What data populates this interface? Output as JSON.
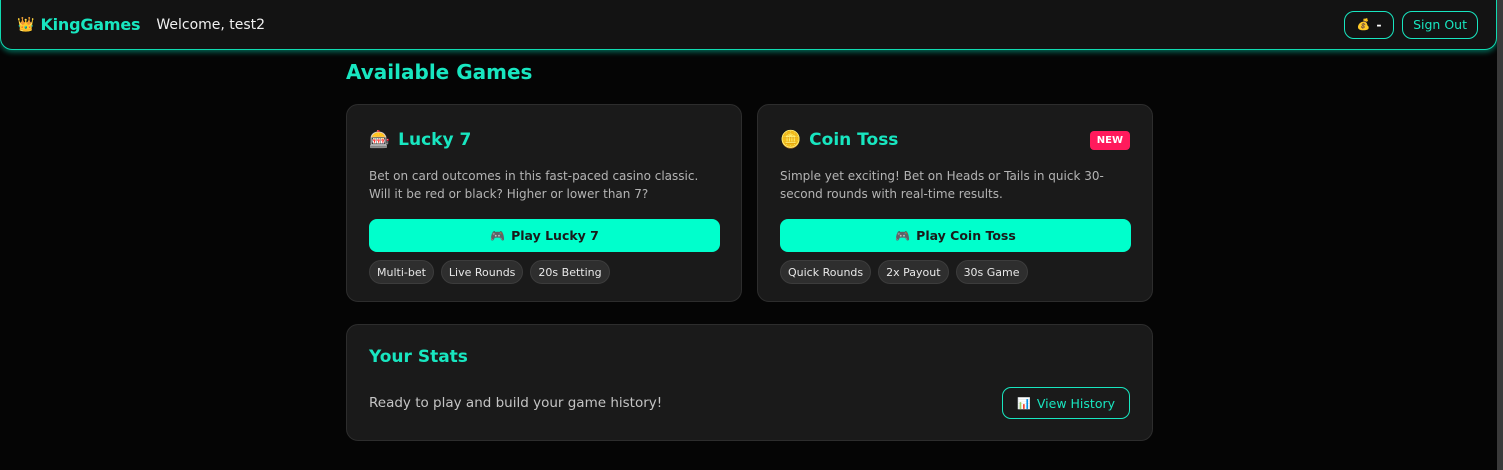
{
  "header": {
    "brand_icon": "👑",
    "brand_name": "KingGames",
    "welcome": "Welcome, test2",
    "balance_icon": "💰",
    "balance_value": "-",
    "sign_out_label": "Sign Out"
  },
  "main": {
    "section_title": "Available Games",
    "games": [
      {
        "icon": "🎰",
        "title": "Lucky 7",
        "description": "Bet on card outcomes in this fast-paced casino classic. Will it be red or black? Higher or lower than 7?",
        "play_icon": "🎮",
        "play_label": "Play Lucky 7",
        "tags": [
          "Multi-bet",
          "Live Rounds",
          "20s Betting"
        ]
      },
      {
        "icon": "🪙",
        "title": "Coin Toss",
        "badge": "NEW",
        "description": "Simple yet exciting! Bet on Heads or Tails in quick 30-second rounds with real-time results.",
        "play_icon": "🎮",
        "play_label": "Play Coin Toss",
        "tags": [
          "Quick Rounds",
          "2x Payout",
          "30s Game"
        ]
      }
    ],
    "stats": {
      "title": "Your Stats",
      "message": "Ready to play and build your game history!",
      "history_icon": "📊",
      "history_label": "View History"
    }
  },
  "colors": {
    "accent": "#18e6c0",
    "play_button": "#00ffcc",
    "badge": "#ff1a5c",
    "background": "#050505",
    "card": "#1a1a1a"
  }
}
